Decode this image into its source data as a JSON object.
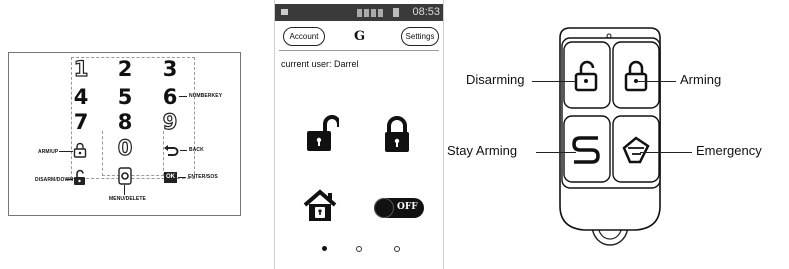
{
  "keypad": {
    "digits": [
      "1",
      "2",
      "3",
      "4",
      "5",
      "6",
      "7",
      "8",
      "9",
      "0"
    ],
    "labels": {
      "numberkey": "NUMBERKEY",
      "arm": "ARM/UP",
      "disarm": "DISARM/DOWN",
      "menu": "MENU/DELETE",
      "back": "BACK",
      "enter": "ENTER/SOS"
    },
    "ok_text": "OK"
  },
  "phone": {
    "status_time": "08:53",
    "account_button": "Account",
    "settings_button": "Settings",
    "app_logo": "G",
    "current_user": "current user: Darrel",
    "toggle_text": "OFF",
    "page_indicator": {
      "total": 3,
      "active": 1
    }
  },
  "remote": {
    "labels": {
      "disarming": "Disarming",
      "arming": "Arming",
      "stay_arming": "Stay Arming",
      "emergency": "Emergency"
    }
  }
}
